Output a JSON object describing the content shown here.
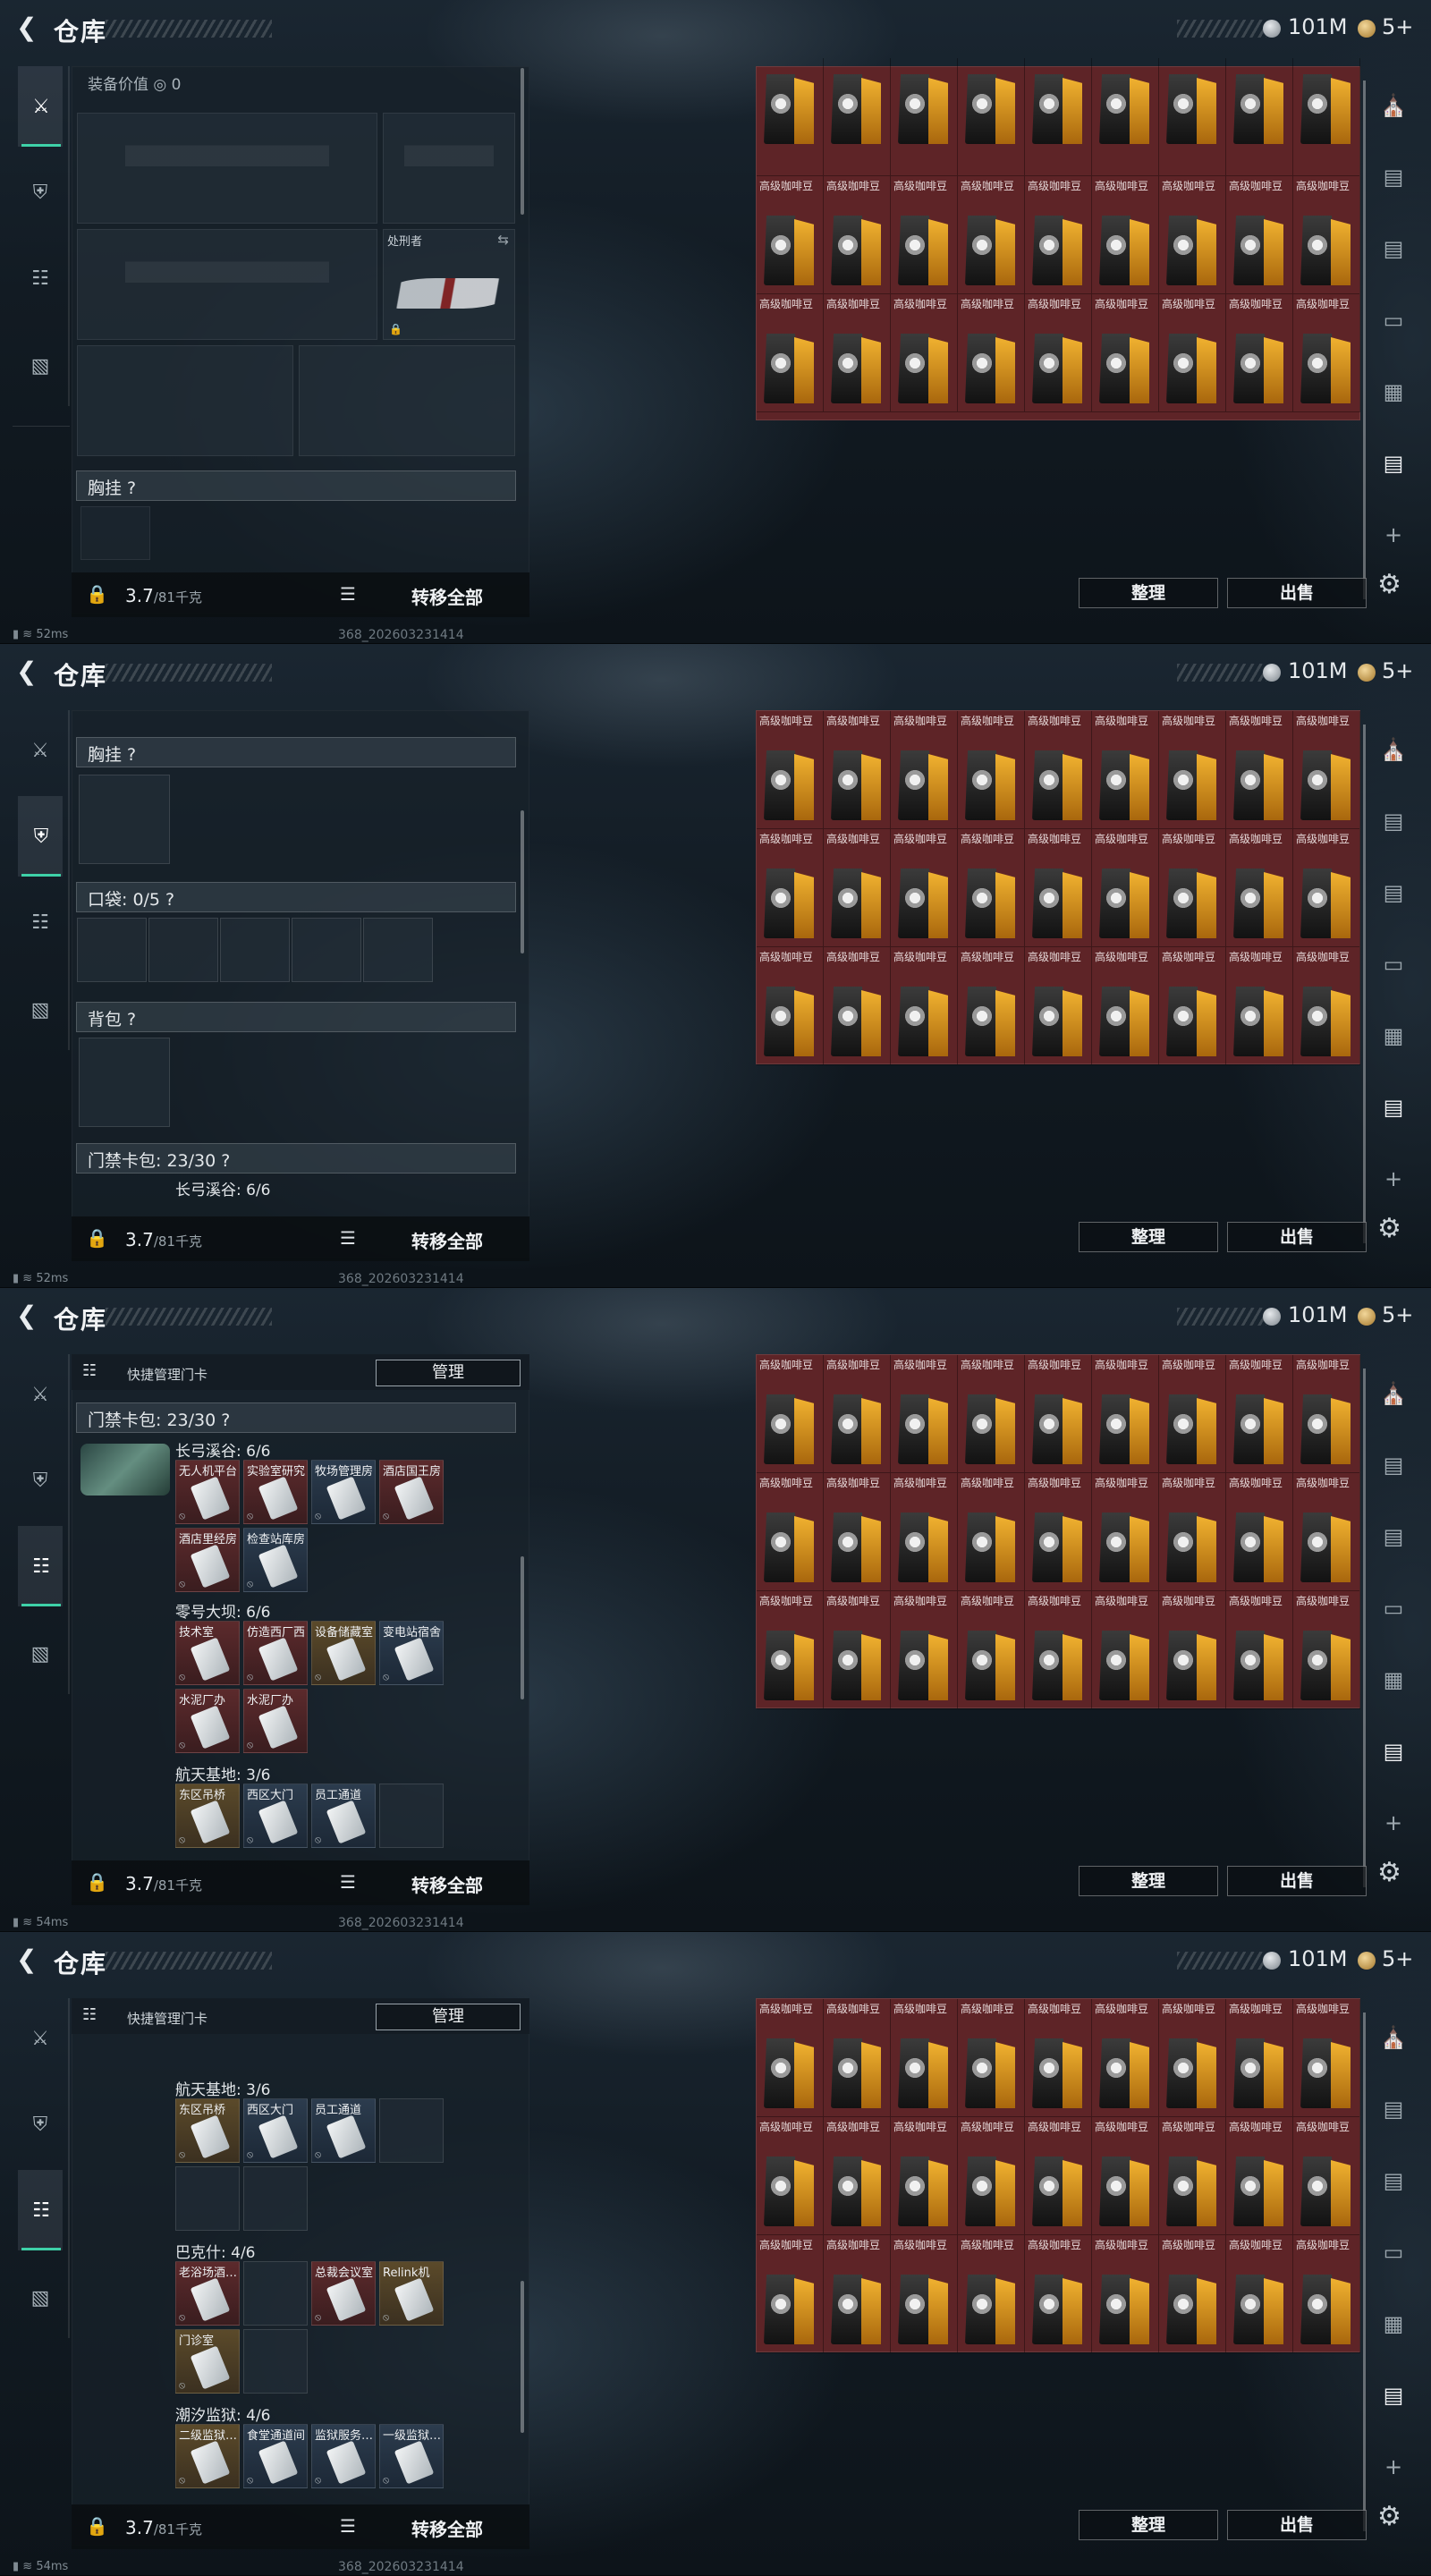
{
  "title": "仓库",
  "currency": {
    "silver": "101M",
    "gold": "5+"
  },
  "bottom": {
    "weight": "3.7",
    "weight_max": "/81千克",
    "transfer_all": "转移全部"
  },
  "buttons": {
    "sort": "整理",
    "sell": "出售",
    "quick_manage": "快捷管理门卡",
    "manage": "管理"
  },
  "status": {
    "ping1": "52ms",
    "ping2": "52ms",
    "ping3": "54ms",
    "ping4": "54ms",
    "build": "368_202603231414"
  },
  "equip": {
    "value_label": "装备价值",
    "value": "0",
    "knife_name": "处刑者"
  },
  "sections": {
    "chest": "胸挂 ?",
    "pocket": "口袋: 0/5 ?",
    "backpack": "背包 ?",
    "keycard": "门禁卡包: 23/30 ?"
  },
  "item_name": "高级咖啡豆",
  "zones": {
    "z1": "长弓溪谷: 6/6",
    "z2": "零号大坝: 6/6",
    "z3": "航天基地: 3/6",
    "z4": "巴克什: 4/6",
    "z5": "潮汐监狱: 4/6"
  },
  "cards": {
    "c1": "无人机平台",
    "c2": "实验室研究",
    "c3": "牧场管理房",
    "c4": "酒店国王房",
    "c5": "酒店里经房",
    "c6": "检查站库房",
    "c7": "技术室",
    "c8": "仿造西厂西",
    "c9": "设备储藏室",
    "c10": "变电站宿舍",
    "c11": "水泥厂办",
    "c12": "水泥厂办",
    "c13": "东区吊桥",
    "c14": "西区大门",
    "c15": "员工通道",
    "c16": "老浴场酒…",
    "c17": "总裁会议室",
    "c18": "Relink机",
    "c19": "门诊室",
    "c20": "二级监狱…",
    "c21": "食堂通道间",
    "c22": "监狱服务…",
    "c23": "一级监狱…"
  },
  "colors": {
    "accent": "#3ed1a8",
    "item_bg": "#5e2427"
  }
}
